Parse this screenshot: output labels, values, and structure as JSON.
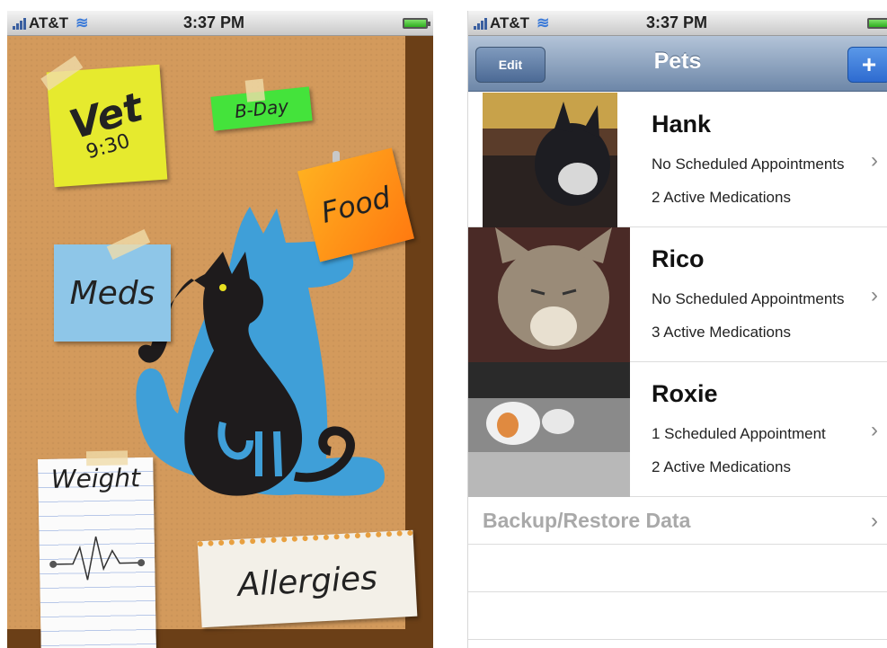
{
  "left_screen": {
    "status": {
      "carrier": "AT&T",
      "time": "3:37 PM"
    },
    "notes": {
      "vet": "Vet",
      "vet_time": "9:30",
      "bday": "B-Day",
      "food": "Food",
      "meds": "Meds",
      "weight": "Weight",
      "allergies": "Allergies"
    }
  },
  "right_screen": {
    "status": {
      "carrier": "AT&T",
      "time": "3:37 PM"
    },
    "navbar": {
      "title": "Pets",
      "edit_label": "Edit",
      "add_label": "+"
    },
    "pets": [
      {
        "name": "Hank",
        "appointments": "No Scheduled Appointments",
        "medications": "2 Active Medications"
      },
      {
        "name": "Rico",
        "appointments": "No Scheduled Appointments",
        "medications": "3 Active Medications"
      },
      {
        "name": "Roxie",
        "appointments": "1 Scheduled Appointment",
        "medications": "2 Active Medications"
      }
    ],
    "backup_label": "Backup/Restore Data"
  },
  "colors": {
    "cork": "#d39a5c",
    "navbar": "#6d87a8",
    "add_button": "#2e6bd0",
    "battery": "#2fae20"
  }
}
